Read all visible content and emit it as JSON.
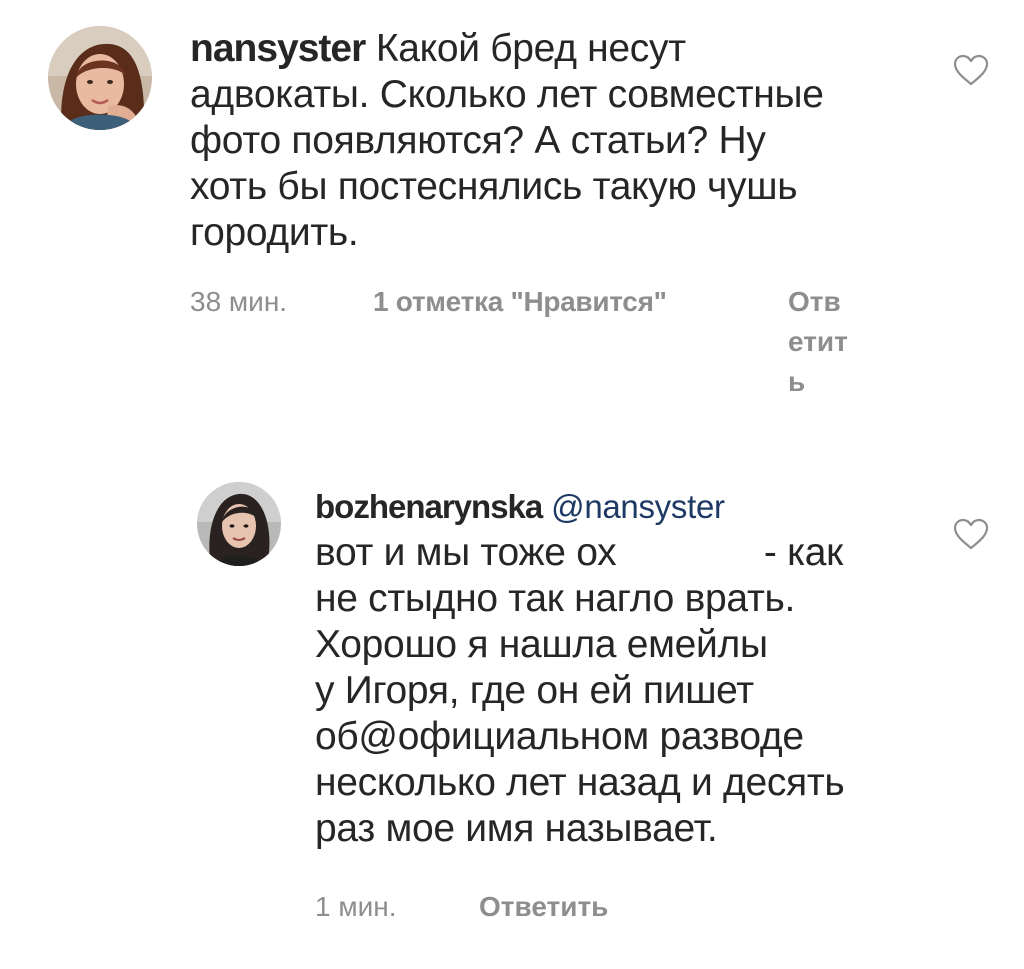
{
  "comments": [
    {
      "username": "nansyster",
      "mention": "",
      "text_lines": [
        "Какой бред несут",
        "адвокаты. Сколько лет совместные",
        "фото появляются? А статьи? Ну",
        "хоть бы постеснялись такую чушь",
        "городить."
      ],
      "time": "38 мин.",
      "likes": "1 отметка \"Нравится\"",
      "reply": "Ответить",
      "like_icon": "heart-outline-icon"
    },
    {
      "username": "bozhenarynska",
      "mention": "@nansyster",
      "text_lines": [
        "вот и мы тоже ох              - как",
        "не стыдно так нагло врать.",
        "Хорошо я нашла емейлы",
        "у Игоря, где он ей пишет",
        "об@официальном разводе",
        "несколько лет назад и десять",
        "раз мое имя называет."
      ],
      "time": "1 мин.",
      "reply": "Ответить",
      "like_icon": "heart-outline-icon"
    }
  ],
  "colors": {
    "text": "#262626",
    "meta": "#8e8e8e",
    "mention": "#1e3a64",
    "heart_stroke": "#8e8e8e"
  }
}
